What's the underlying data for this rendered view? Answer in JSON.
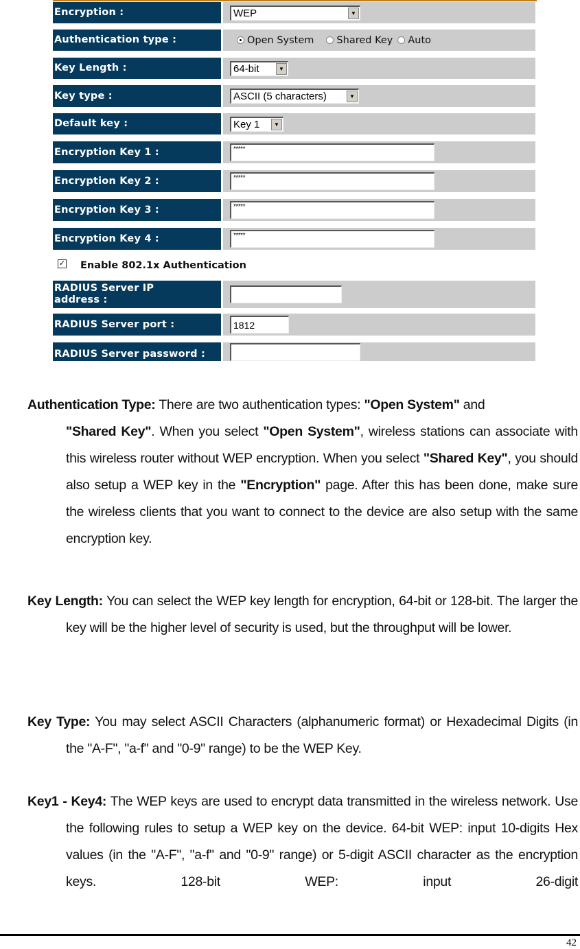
{
  "form": {
    "encryption": {
      "label": "Encryption :",
      "value": "WEP"
    },
    "auth_type": {
      "label": "Authentication type :",
      "options": [
        "Open System",
        "Shared Key",
        "Auto"
      ],
      "selected": "Open System"
    },
    "key_length": {
      "label": "Key Length :",
      "value": "64-bit"
    },
    "key_type": {
      "label": "Key type :",
      "value": "ASCII (5 characters)"
    },
    "default_key": {
      "label": "Default key :",
      "value": "Key 1"
    },
    "keys": [
      {
        "label": "Encryption Key 1 :",
        "value": "*****"
      },
      {
        "label": "Encryption Key 2 :",
        "value": "*****"
      },
      {
        "label": "Encryption Key 3 :",
        "value": "*****"
      },
      {
        "label": "Encryption Key 4 :",
        "value": "*****"
      }
    ],
    "enable_8021x": {
      "label": "Enable 802.1x Authentication",
      "checked": true
    },
    "radius_ip": {
      "label": "RADIUS Server IP address :",
      "value": ""
    },
    "radius_port": {
      "label": "RADIUS Server port :",
      "value": "1812"
    },
    "radius_password": {
      "label": "RADIUS Server password :",
      "value": ""
    }
  },
  "doc": {
    "auth": {
      "term": "Authentication Type:",
      "t1": " There are two authentication types: ",
      "b1": "\"Open System\"",
      "t2": " and ",
      "b2": "\"Shared Key\"",
      "t3": ". When you select ",
      "b3": "\"Open System\"",
      "t4": ", wireless stations can associate with this wireless router without WEP encryption. When you select ",
      "b4": "\"Shared Key\"",
      "t5": ", you should also setup a WEP key in the ",
      "b5": "\"Encryption\"",
      "t6": " page. After this has been done, make sure the wireless clients that you want to connect to the device are also setup with the same encryption key."
    },
    "keylen": {
      "term": "Key Length:",
      "text": " You can select the WEP key length for encryption, 64-bit or 128-bit. The larger the key will be the higher level of security is used, but the throughput will be lower."
    },
    "keytype": {
      "term": "Key Type:",
      "text": " You may select ASCII Characters (alphanumeric format) or Hexadecimal Digits (in the \"A-F\", \"a-f\" and \"0-9\" range) to be the WEP Key."
    },
    "keys": {
      "term": "Key1 - Key4:",
      "text": " The WEP keys are used to encrypt data transmitted in the wireless network. Use the following rules to setup a WEP key on the device. 64-bit WEP: input 10-digits Hex values (in the \"A-F\", \"a-f\" and \"0-9\" range) or 5-digit ASCII character as the encryption keys. 128-bit WEP: input 26-digit"
    }
  },
  "page_number": "42"
}
